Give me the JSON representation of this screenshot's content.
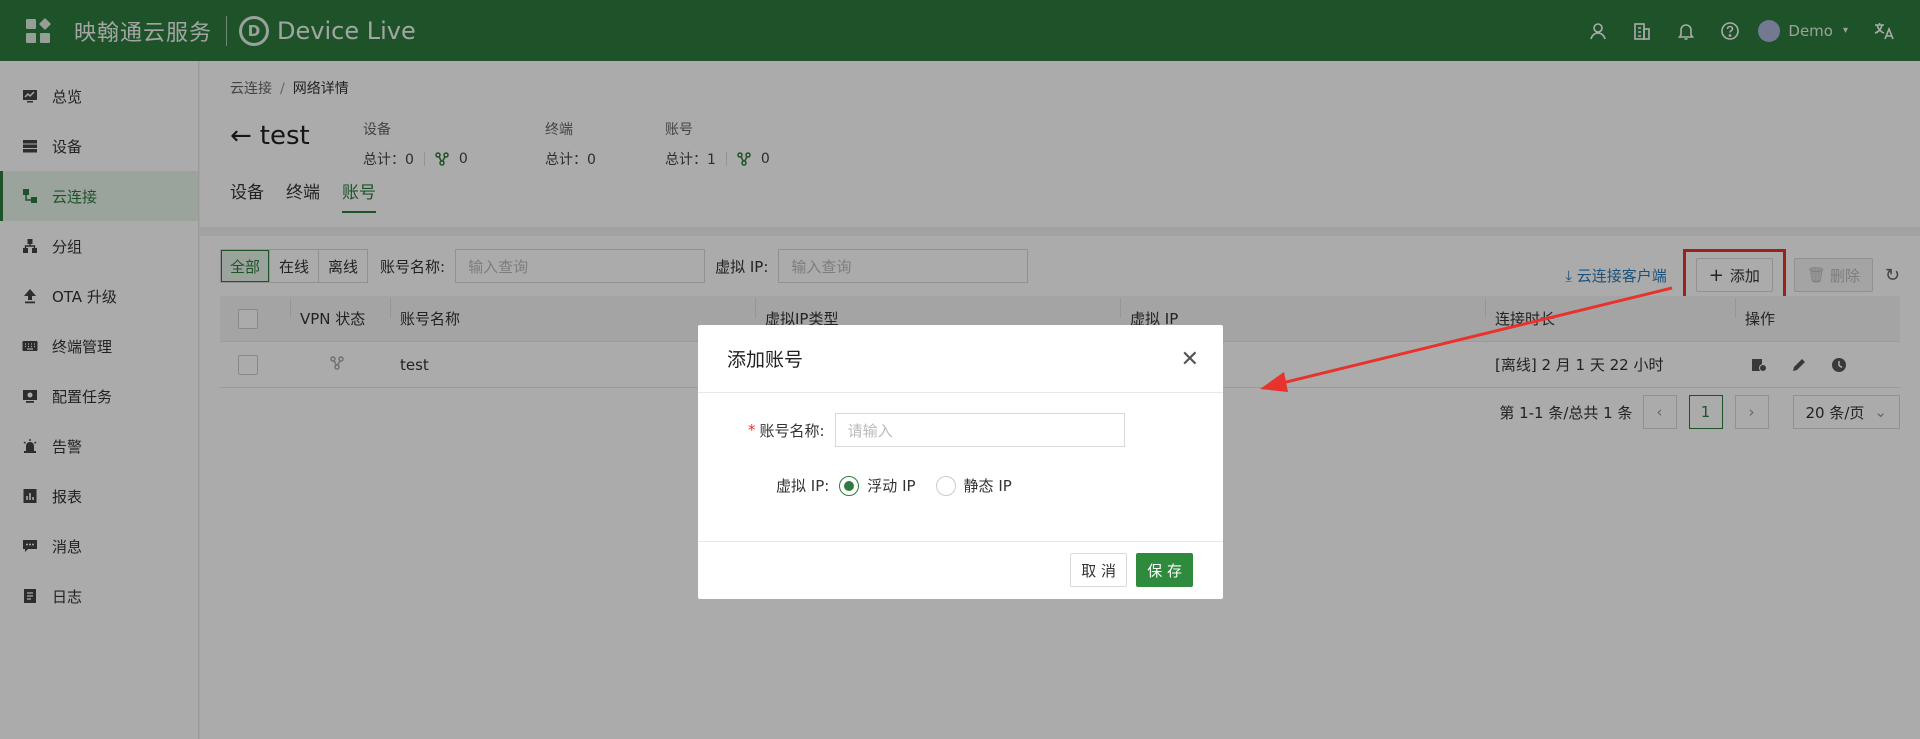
{
  "topbar": {
    "brand": "映翰通云服务",
    "product": "Device Live",
    "user": "Demo"
  },
  "sidebar": {
    "items": [
      {
        "label": "总览",
        "icon": "dashboard-icon"
      },
      {
        "label": "设备",
        "icon": "device-icon"
      },
      {
        "label": "云连接",
        "icon": "cloud-connect-icon",
        "active": true
      },
      {
        "label": "分组",
        "icon": "group-icon"
      },
      {
        "label": "OTA 升级",
        "icon": "upload-icon"
      },
      {
        "label": "终端管理",
        "icon": "keyboard-icon"
      },
      {
        "label": "配置任务",
        "icon": "config-icon"
      },
      {
        "label": "告警",
        "icon": "alarm-icon"
      },
      {
        "label": "报表",
        "icon": "report-icon"
      },
      {
        "label": "消息",
        "icon": "message-icon"
      },
      {
        "label": "日志",
        "icon": "log-icon"
      }
    ]
  },
  "breadcrumb": {
    "parent": "云连接",
    "separator": "/",
    "current": "网络详情"
  },
  "page": {
    "title": "test"
  },
  "stats": {
    "device": {
      "label": "设备",
      "total": "总计：0",
      "online": "0"
    },
    "terminal": {
      "label": "终端",
      "total": "总计：0"
    },
    "account": {
      "label": "账号",
      "total": "总计：1",
      "online": "0"
    }
  },
  "tabs": [
    "设备",
    "终端",
    "账号"
  ],
  "filters": {
    "segments": [
      "全部",
      "在线",
      "离线"
    ],
    "account_label": "账号名称:",
    "account_placeholder": "输入查询",
    "vip_label": "虚拟 IP:",
    "vip_placeholder": "输入查询"
  },
  "actions": {
    "client_link": "云连接客户端",
    "add": "添加",
    "delete": "删除"
  },
  "table": {
    "headers": [
      "VPN 状态",
      "账号名称",
      "虚拟IP类型",
      "虚拟 IP",
      "连接时长",
      "操作"
    ],
    "rows": [
      {
        "name": "test",
        "duration": "[离线] 2 月 1 天 22 小时"
      }
    ]
  },
  "pagination": {
    "summary": "第 1-1 条/总共 1 条",
    "current": "1",
    "page_size": "20 条/页"
  },
  "modal": {
    "title": "添加账号",
    "name_label": "账号名称:",
    "name_placeholder": "请输入",
    "vip_label": "虚拟 IP:",
    "option_floating": "浮动 IP",
    "option_static": "静态 IP",
    "cancel": "取 消",
    "save": "保 存"
  },
  "colors": {
    "brand": "#2e7d3e",
    "annotation": "#e8322c"
  }
}
